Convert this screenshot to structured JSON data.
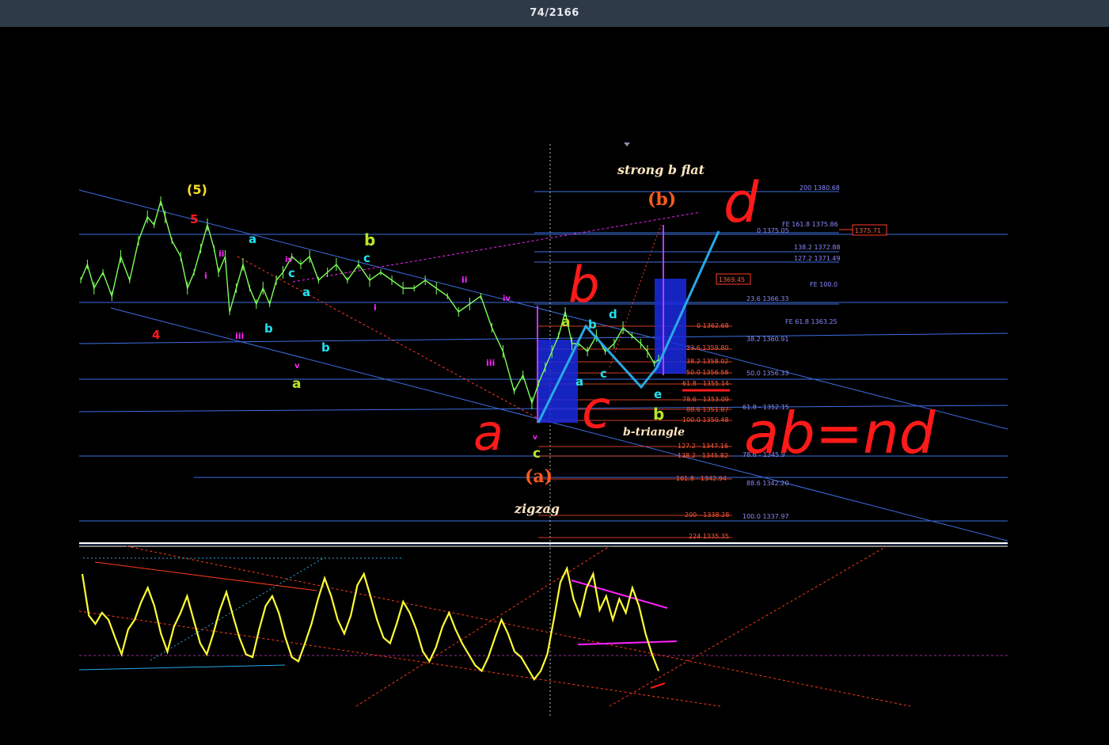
{
  "viewer": {
    "counter": "74/2166"
  },
  "colors": {
    "background": "#000000",
    "price": "#7cff5a",
    "channel": "#3d6fe0",
    "fib_blue": "#7a7ae6",
    "fib_red": "#ff4a2a",
    "oscillator": "#ffff33",
    "marker_red": "#ff1a1a",
    "marker_blue": "#2aa9e6"
  },
  "chart_data": {
    "type": "line",
    "title": "",
    "xlabel": "",
    "ylabel": "",
    "ylim": [
      1333,
      1383
    ],
    "price_path": [
      [
        0,
        1366
      ],
      [
        3,
        1368
      ],
      [
        6,
        1365
      ],
      [
        10,
        1367
      ],
      [
        14,
        1364
      ],
      [
        18,
        1369
      ],
      [
        22,
        1366
      ],
      [
        26,
        1371
      ],
      [
        30,
        1374
      ],
      [
        33,
        1373
      ],
      [
        36,
        1376
      ],
      [
        38,
        1374
      ],
      [
        41,
        1371
      ],
      [
        45,
        1369
      ],
      [
        48,
        1365
      ],
      [
        51,
        1367
      ],
      [
        54,
        1370
      ],
      [
        57,
        1373
      ],
      [
        60,
        1370
      ],
      [
        62,
        1367
      ],
      [
        65,
        1369
      ],
      [
        67,
        1362
      ],
      [
        70,
        1365
      ],
      [
        73,
        1368
      ],
      [
        76,
        1365
      ],
      [
        79,
        1363
      ],
      [
        82,
        1365
      ],
      [
        85,
        1363
      ],
      [
        88,
        1366
      ],
      [
        91,
        1367
      ],
      [
        95,
        1369
      ],
      [
        99,
        1368
      ],
      [
        103,
        1369
      ],
      [
        107,
        1366
      ],
      [
        111,
        1367
      ],
      [
        115,
        1368
      ],
      [
        120,
        1366
      ],
      [
        125,
        1368
      ],
      [
        130,
        1366
      ],
      [
        135,
        1367
      ],
      [
        140,
        1366
      ],
      [
        145,
        1365
      ],
      [
        150,
        1365
      ],
      [
        155,
        1366
      ],
      [
        160,
        1365
      ],
      [
        165,
        1364
      ],
      [
        170,
        1362
      ],
      [
        175,
        1363
      ],
      [
        180,
        1364
      ],
      [
        185,
        1360
      ],
      [
        190,
        1357
      ],
      [
        195,
        1352
      ],
      [
        199,
        1354
      ],
      [
        203,
        1350.5
      ],
      [
        206,
        1353
      ],
      [
        209,
        1355
      ],
      [
        212,
        1357
      ],
      [
        215,
        1359
      ],
      [
        218,
        1362
      ],
      [
        221,
        1358
      ],
      [
        224,
        1358
      ],
      [
        228,
        1357
      ],
      [
        232,
        1359
      ],
      [
        236,
        1357
      ],
      [
        240,
        1358
      ],
      [
        244,
        1360
      ],
      [
        248,
        1359
      ],
      [
        252,
        1358
      ],
      [
        255,
        1357
      ],
      [
        258,
        1355.5
      ],
      [
        260,
        1356
      ]
    ],
    "wave_labels": [
      {
        "text": "(5)",
        "color": "#ffe022"
      },
      {
        "text": "5",
        "color": "#ff1a1a"
      },
      {
        "text": "4",
        "color": "#ff1a1a"
      },
      {
        "text": "i",
        "color": "#ff22ff"
      },
      {
        "text": "ii",
        "color": "#ff22ff"
      },
      {
        "text": "iii",
        "color": "#ff22ff"
      },
      {
        "text": "iv",
        "color": "#ff22ff"
      },
      {
        "text": "v",
        "color": "#ff22ff"
      },
      {
        "text": "a",
        "color": "#22e0f0"
      },
      {
        "text": "b",
        "color": "#22e0f0"
      },
      {
        "text": "c",
        "color": "#22e0f0"
      },
      {
        "text": "a",
        "color": "#22e0f0"
      },
      {
        "text": "b",
        "color": "#22e0f0"
      },
      {
        "text": "a",
        "color": "#b8e62a"
      },
      {
        "text": "b",
        "color": "#b8e62a"
      },
      {
        "text": "c",
        "color": "#22e0f0"
      },
      {
        "text": "i",
        "color": "#ff22ff"
      },
      {
        "text": "ii",
        "color": "#ff22ff"
      },
      {
        "text": "iv",
        "color": "#ff22ff"
      },
      {
        "text": "iii",
        "color": "#ff22ff"
      },
      {
        "text": "v",
        "color": "#ff22ff"
      },
      {
        "text": "c",
        "color": "#b8e62a"
      },
      {
        "text": "a",
        "color": "#b8e62a"
      },
      {
        "text": "b",
        "color": "#22e0f0"
      },
      {
        "text": "d",
        "color": "#22e0f0"
      },
      {
        "text": "a",
        "color": "#22e0f0"
      },
      {
        "text": "c",
        "color": "#22e0f0"
      },
      {
        "text": "e",
        "color": "#22e0f0"
      },
      {
        "text": "b",
        "color": "#b8e62a"
      }
    ],
    "annotations": {
      "strong_b_flat": "strong b flat",
      "wave_b": "(b)",
      "wave_a": "(a)",
      "zigzag": "zigzag",
      "b_triangle": "b-triangle"
    },
    "handwriting": {
      "a": "a",
      "b": "b",
      "c": "c",
      "d": "d",
      "formula": "ab=nd"
    },
    "price_boxes": [
      "1375.71",
      "1369.45"
    ],
    "fib_blue_labels": [
      "200 1380.68",
      "FE 161.8 1375.86",
      "0 1375.05",
      "138.2 1372.88",
      "127.2 1371.49",
      "FE 100.0",
      "23.6 1366.33",
      "FE 61.8 1363.25",
      "38.2 1360.91",
      "50.0 1356.33",
      "61.8 - 1352.15",
      "78.6 - 1345.9",
      "88.6 1342.20",
      "100.0 1337.97"
    ],
    "fib_red_labels": [
      "0 1362.68",
      "23.6 1359.80",
      "38.2 1358.02",
      "50.0 1356.58",
      "61.8 - 1355.14",
      "78.6 - 1353.09",
      "88.6 1351.87",
      "100.0 1350.48",
      "127.2 - 1347.16",
      "138.2 - 1345.82",
      "161.8 - 1342.94",
      "200 - 1338.28",
      "224 1335.35"
    ],
    "oscillator": {
      "ylim": [
        0,
        100
      ],
      "values": [
        88,
        58,
        52,
        60,
        55,
        42,
        30,
        48,
        55,
        68,
        78,
        65,
        45,
        32,
        50,
        60,
        72,
        55,
        38,
        30,
        45,
        62,
        75,
        58,
        42,
        30,
        28,
        48,
        65,
        72,
        60,
        42,
        28,
        25,
        38,
        52,
        70,
        85,
        72,
        55,
        45,
        58,
        80,
        88,
        72,
        55,
        42,
        38,
        52,
        68,
        60,
        48,
        32,
        25,
        35,
        50,
        60,
        48,
        38,
        30,
        22,
        18,
        28,
        42,
        55,
        45,
        32,
        28,
        20,
        12,
        18,
        30,
        55,
        82,
        92,
        70,
        58,
        78,
        88,
        62,
        72,
        55,
        70,
        60,
        78,
        65,
        45,
        30,
        18
      ]
    }
  }
}
